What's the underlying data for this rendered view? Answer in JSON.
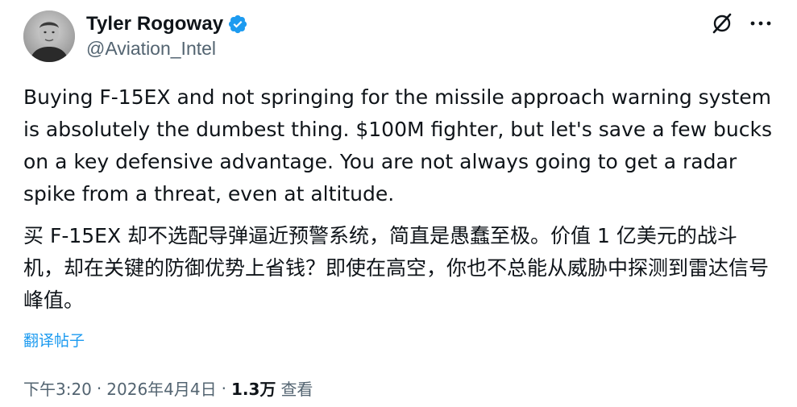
{
  "author": {
    "display_name": "Tyler Rogoway",
    "handle": "@Aviation_Intel",
    "verified": true,
    "avatar_icon": "profile-photo"
  },
  "actions": {
    "grok_icon": "grok-icon",
    "more_icon": "more-icon"
  },
  "tweet": {
    "text_en": "Buying F-15EX and not springing for the missile approach warning system is absolutely the dumbest thing. $100M fighter, but let's save a few bucks on a key defensive advantage. You are not always going to get a radar spike from a threat, even at altitude.",
    "text_zh": "买 F-15EX 却不选配导弹逼近预警系统，简直是愚蠢至极。价值 1 亿美元的战斗机，却在关键的防御优势上省钱？即使在高空，你也不总能从威胁中探测到雷达信号峰值。",
    "translate_label": "翻译帖子"
  },
  "meta": {
    "time": "下午3:20",
    "separator": "·",
    "date": "2026年4月4日",
    "views_count": "1.3万",
    "views_label": "查看"
  },
  "colors": {
    "text": "#0f1419",
    "secondary": "#536471",
    "accent": "#1d9bf0"
  }
}
